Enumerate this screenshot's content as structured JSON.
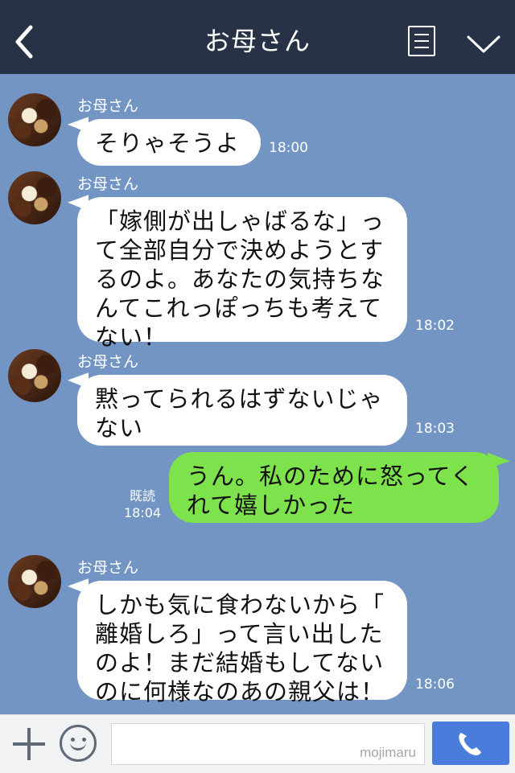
{
  "header": {
    "title": "お母さん"
  },
  "messages": [
    {
      "sender": "お母さん",
      "text": "そりゃそうよ",
      "time": "18:00"
    },
    {
      "sender": "お母さん",
      "text": "「嫁側が出しゃばるな」っ\nて全部自分で決めようとす\nるのよ。あなたの気持ちな\nんてこれっぽっちも考えて\nない！",
      "time": "18:02"
    },
    {
      "sender": "お母さん",
      "text": "黙ってられるはずないじゃ\nない",
      "time": "18:03"
    },
    {
      "text": "うん。私のために怒ってく\nれて嬉しかった",
      "read": "既読",
      "time": "18:04"
    },
    {
      "sender": "お母さん",
      "text": "しかも気に食わないから「\n離婚しろ」って言い出した\nのよ！まだ結婚もしてない\nのに何様なのあの親父は！",
      "time": "18:06"
    }
  ],
  "input": {
    "watermark": "mojimaru",
    "placeholder": ""
  },
  "icons": {
    "back": "chevron-left-icon",
    "menu": "menu-list-icon",
    "collapse": "chevron-down-icon",
    "add": "plus-icon",
    "sticker": "smiley-icon",
    "call": "phone-icon"
  },
  "colors": {
    "header": "#273246",
    "chat_background": "#7395c4",
    "my_bubble": "#7ee24d",
    "their_bubble": "#ffffff",
    "call_button": "#4a7cdc"
  }
}
